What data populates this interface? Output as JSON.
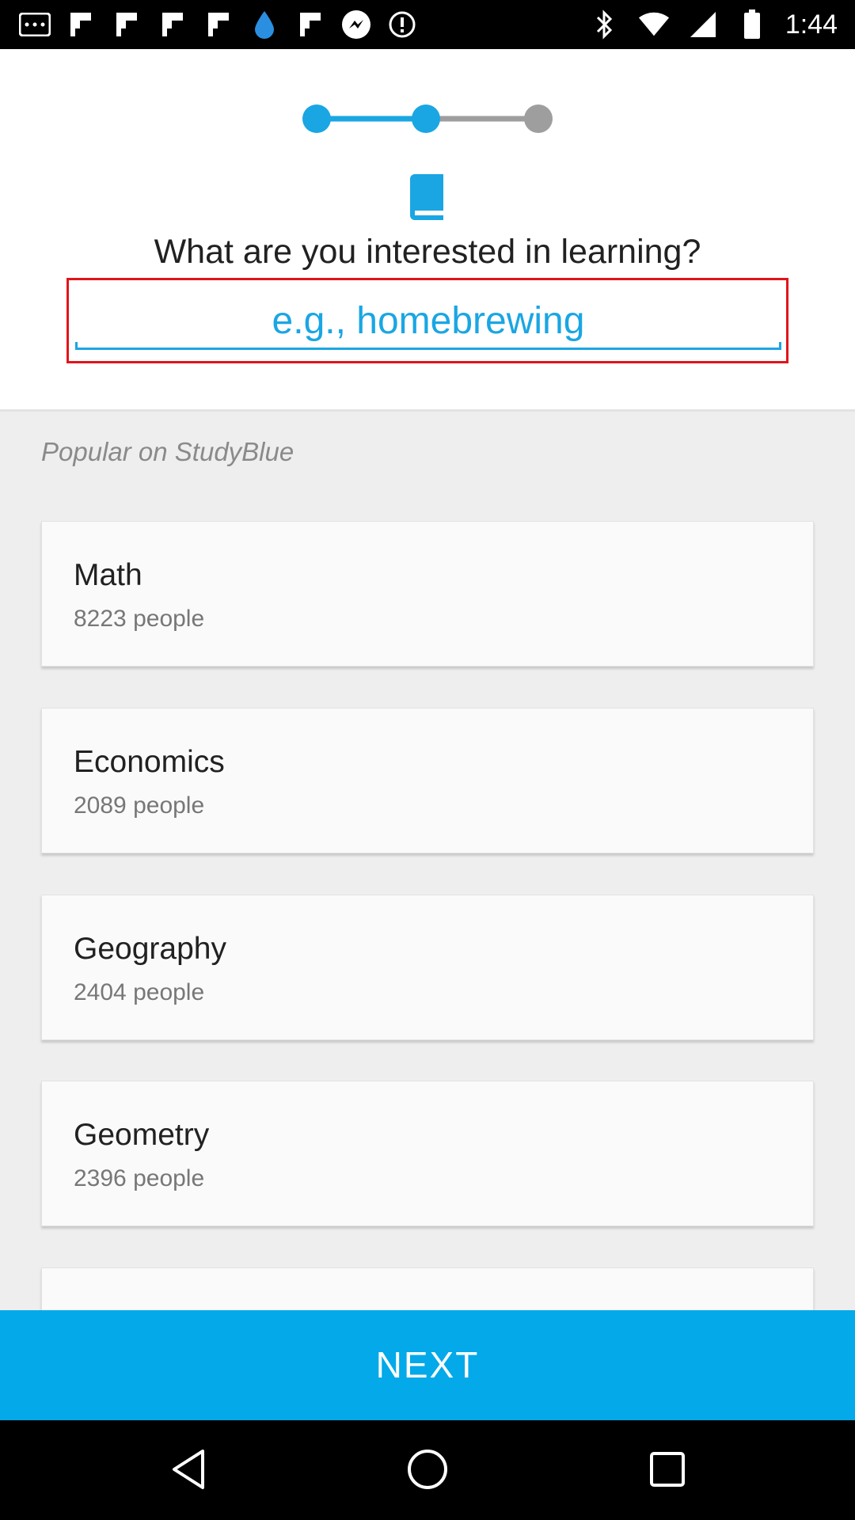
{
  "status_bar": {
    "time": "1:44",
    "left_icons": [
      "photos-icon",
      "flipboard-icon",
      "flipboard-icon",
      "flipboard-icon",
      "flipboard-icon",
      "water-drop-icon",
      "flipboard-icon",
      "messenger-icon",
      "info-circle-icon"
    ],
    "right_icons": [
      "bluetooth-icon",
      "wifi-icon",
      "signal-icon",
      "battery-icon"
    ]
  },
  "onboarding": {
    "question": "What are you interested in learning?",
    "search_placeholder": "e.g., homebrewing",
    "search_value": ""
  },
  "popular": {
    "title": "Popular on StudyBlue",
    "items": [
      {
        "name": "Math",
        "count": "8223 people"
      },
      {
        "name": "Economics",
        "count": "2089 people"
      },
      {
        "name": "Geography",
        "count": "2404 people"
      },
      {
        "name": "Geometry",
        "count": "2396 people"
      }
    ]
  },
  "footer": {
    "next_label": "NEXT"
  },
  "colors": {
    "accent": "#03a9e9",
    "highlight_border": "#e1151a",
    "input_text": "#1aa6e3"
  }
}
